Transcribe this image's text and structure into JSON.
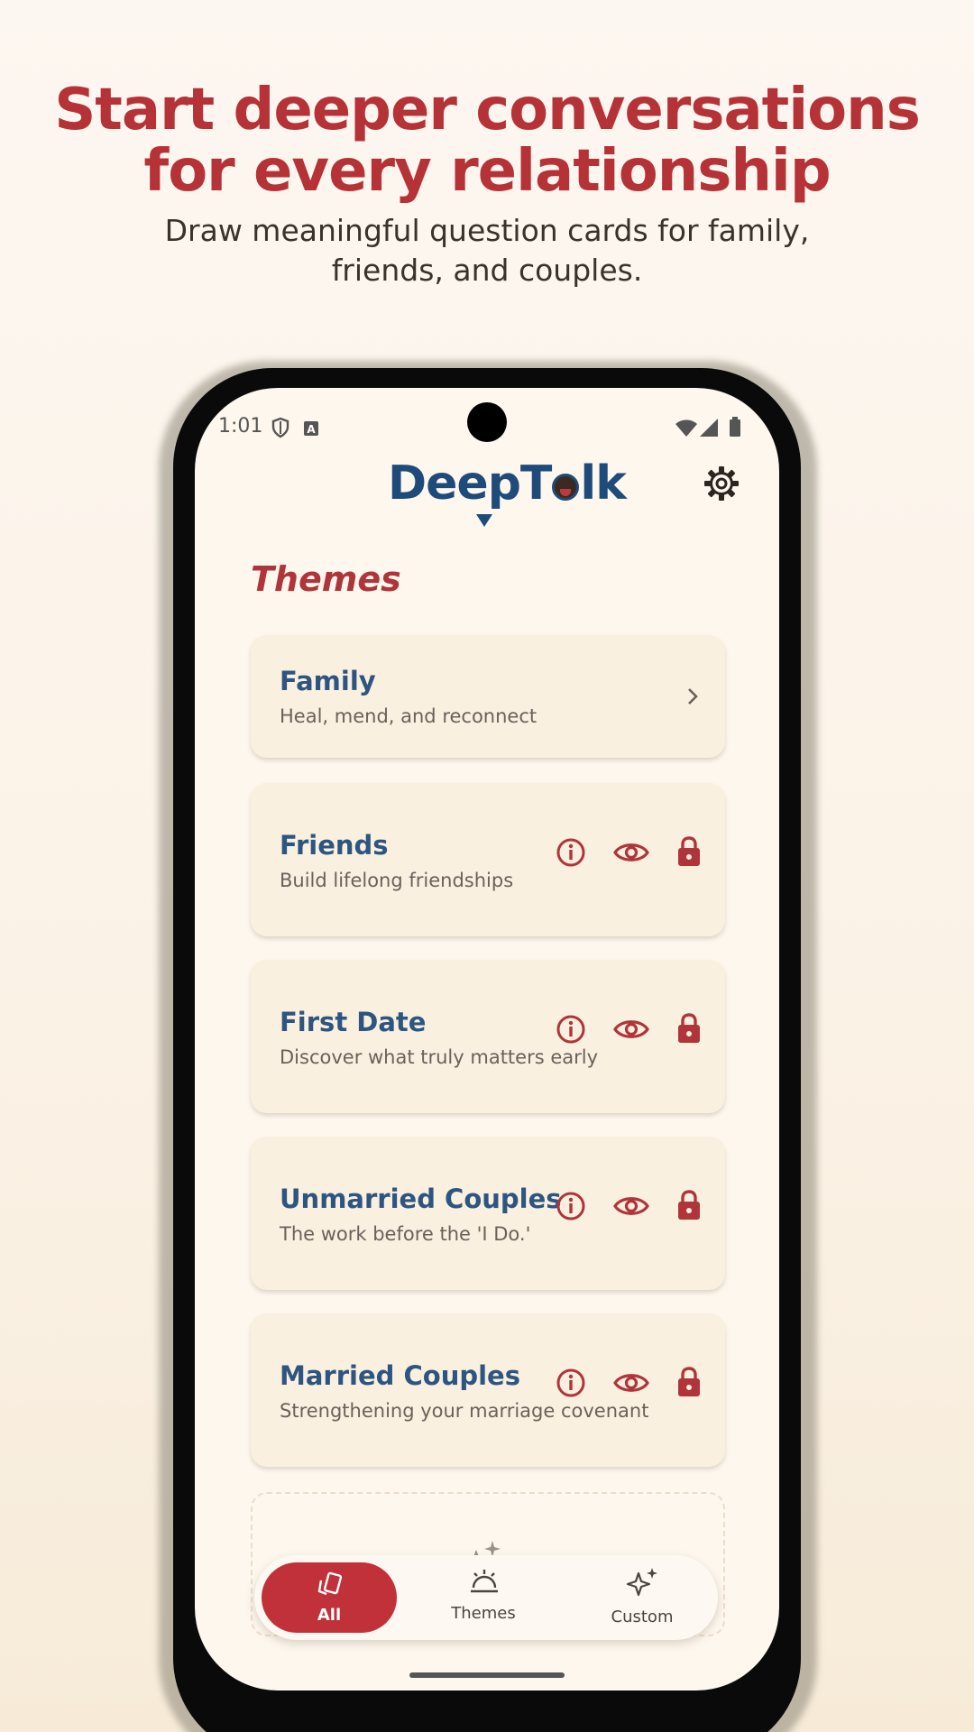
{
  "promo": {
    "headline_line1": "Start deeper conversations",
    "headline_line2": "for every relationship",
    "subline_line1": "Draw meaningful question cards for family,",
    "subline_line2": "friends, and couples."
  },
  "status_bar": {
    "time": "1:01",
    "icons": [
      "shield-icon",
      "a-badge-icon",
      "wifi-icon",
      "signal-icon",
      "battery-icon"
    ]
  },
  "app": {
    "logo_left": "DeepT",
    "logo_right": "lk",
    "settings_icon": "gear-icon",
    "section_title": "Themes",
    "accent_color": "#b0353a",
    "title_color": "#2e5580"
  },
  "themes": [
    {
      "title": "Family",
      "subtitle": "Heal, mend, and reconnect",
      "locked": false
    },
    {
      "title": "Friends",
      "subtitle": "Build lifelong friendships",
      "locked": true
    },
    {
      "title": "First Date",
      "subtitle": "Discover what truly matters early",
      "locked": true
    },
    {
      "title": "Unmarried Couples",
      "subtitle": "The work before the 'I Do.'",
      "locked": true
    },
    {
      "title": "Married Couples",
      "subtitle": "Strengthening your marriage covenant",
      "locked": true
    }
  ],
  "nav": {
    "all_label": "All",
    "themes_label": "Themes",
    "custom_label": "Custom",
    "active": "All"
  }
}
